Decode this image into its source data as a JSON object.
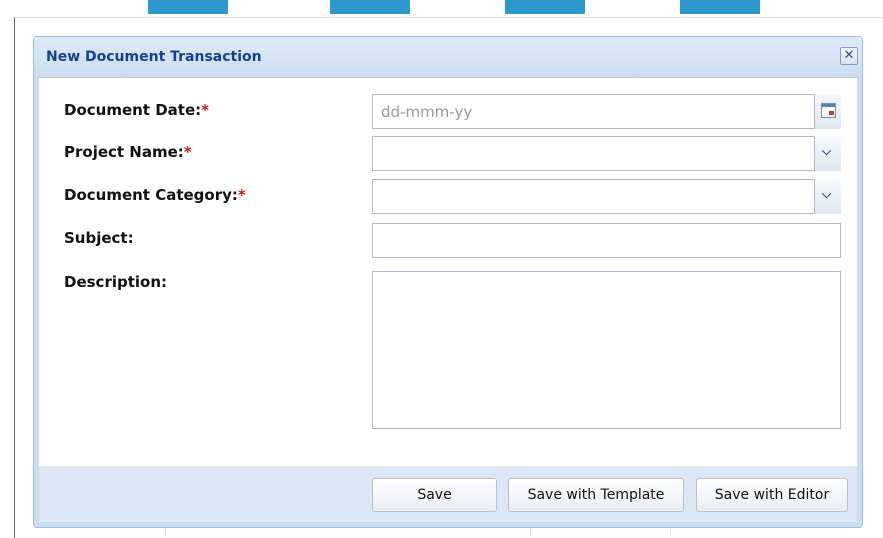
{
  "dialog": {
    "title": "New Document Transaction",
    "close_symbol": "✕",
    "close_icon": "close-icon"
  },
  "form": {
    "document_date": {
      "label": "Document Date:",
      "required": "*",
      "value": "",
      "placeholder": "dd-mmm-yy",
      "trigger_icon": "calendar-icon"
    },
    "project_name": {
      "label": "Project Name:",
      "required": "*",
      "value": "",
      "trigger_icon": "chevron-down-icon"
    },
    "document_category": {
      "label": "Document Category:",
      "required": "*",
      "value": "",
      "trigger_icon": "chevron-down-icon"
    },
    "subject": {
      "label": "Subject:",
      "value": ""
    },
    "description": {
      "label": "Description:",
      "value": ""
    }
  },
  "footer": {
    "save_label": "Save",
    "save_template_label": "Save with Template",
    "save_editor_label": "Save with Editor"
  },
  "colors": {
    "title": "#15428b",
    "required": "#d21b1b",
    "frame": "#99bbe8",
    "footer": "#dce7f5"
  }
}
